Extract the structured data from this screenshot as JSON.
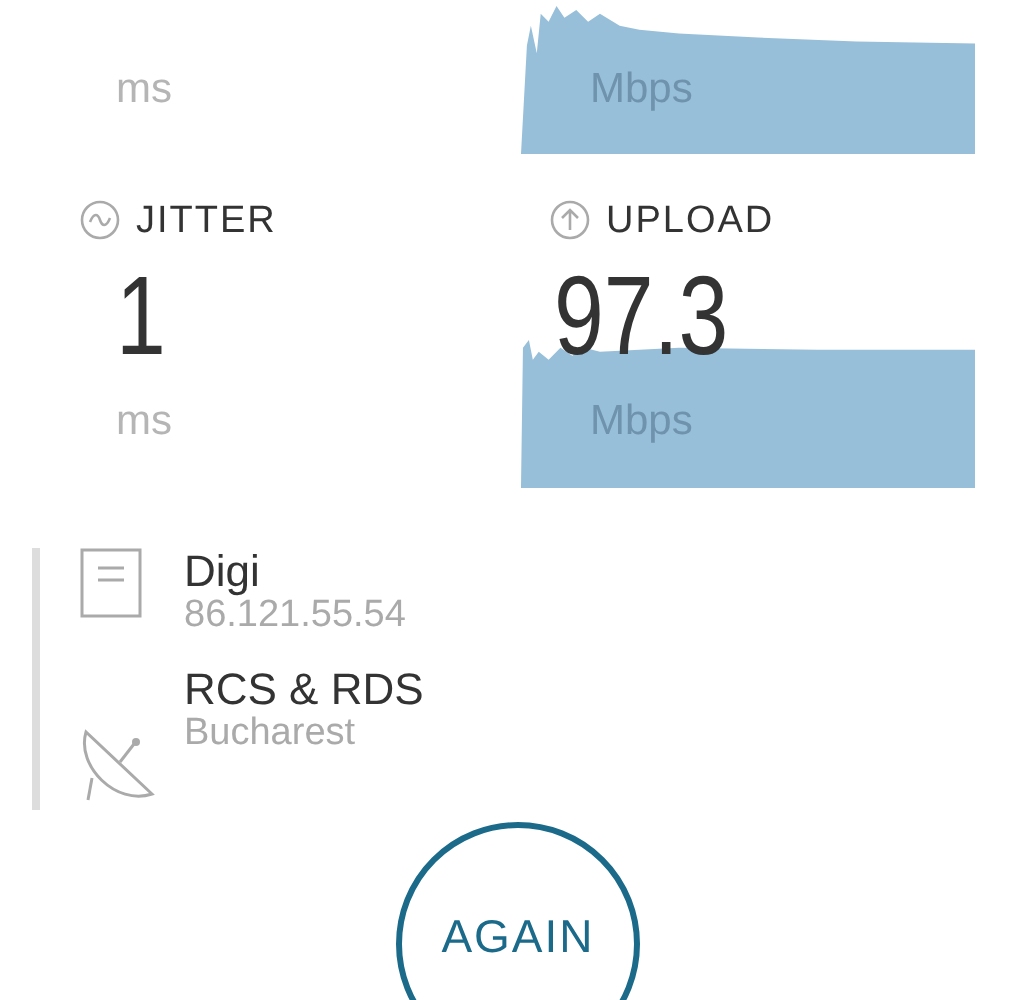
{
  "top_row": {
    "left": {
      "unit": "ms"
    },
    "right": {
      "unit": "Mbps"
    }
  },
  "jitter": {
    "label": "JITTER",
    "value": "1",
    "unit": "ms"
  },
  "upload": {
    "label": "UPLOAD",
    "value": "97.3",
    "unit": "Mbps"
  },
  "server": {
    "isp": "Digi",
    "ip": "86.121.55.54",
    "host": "RCS & RDS",
    "location": "Bucharest"
  },
  "button": "AGAIN"
}
